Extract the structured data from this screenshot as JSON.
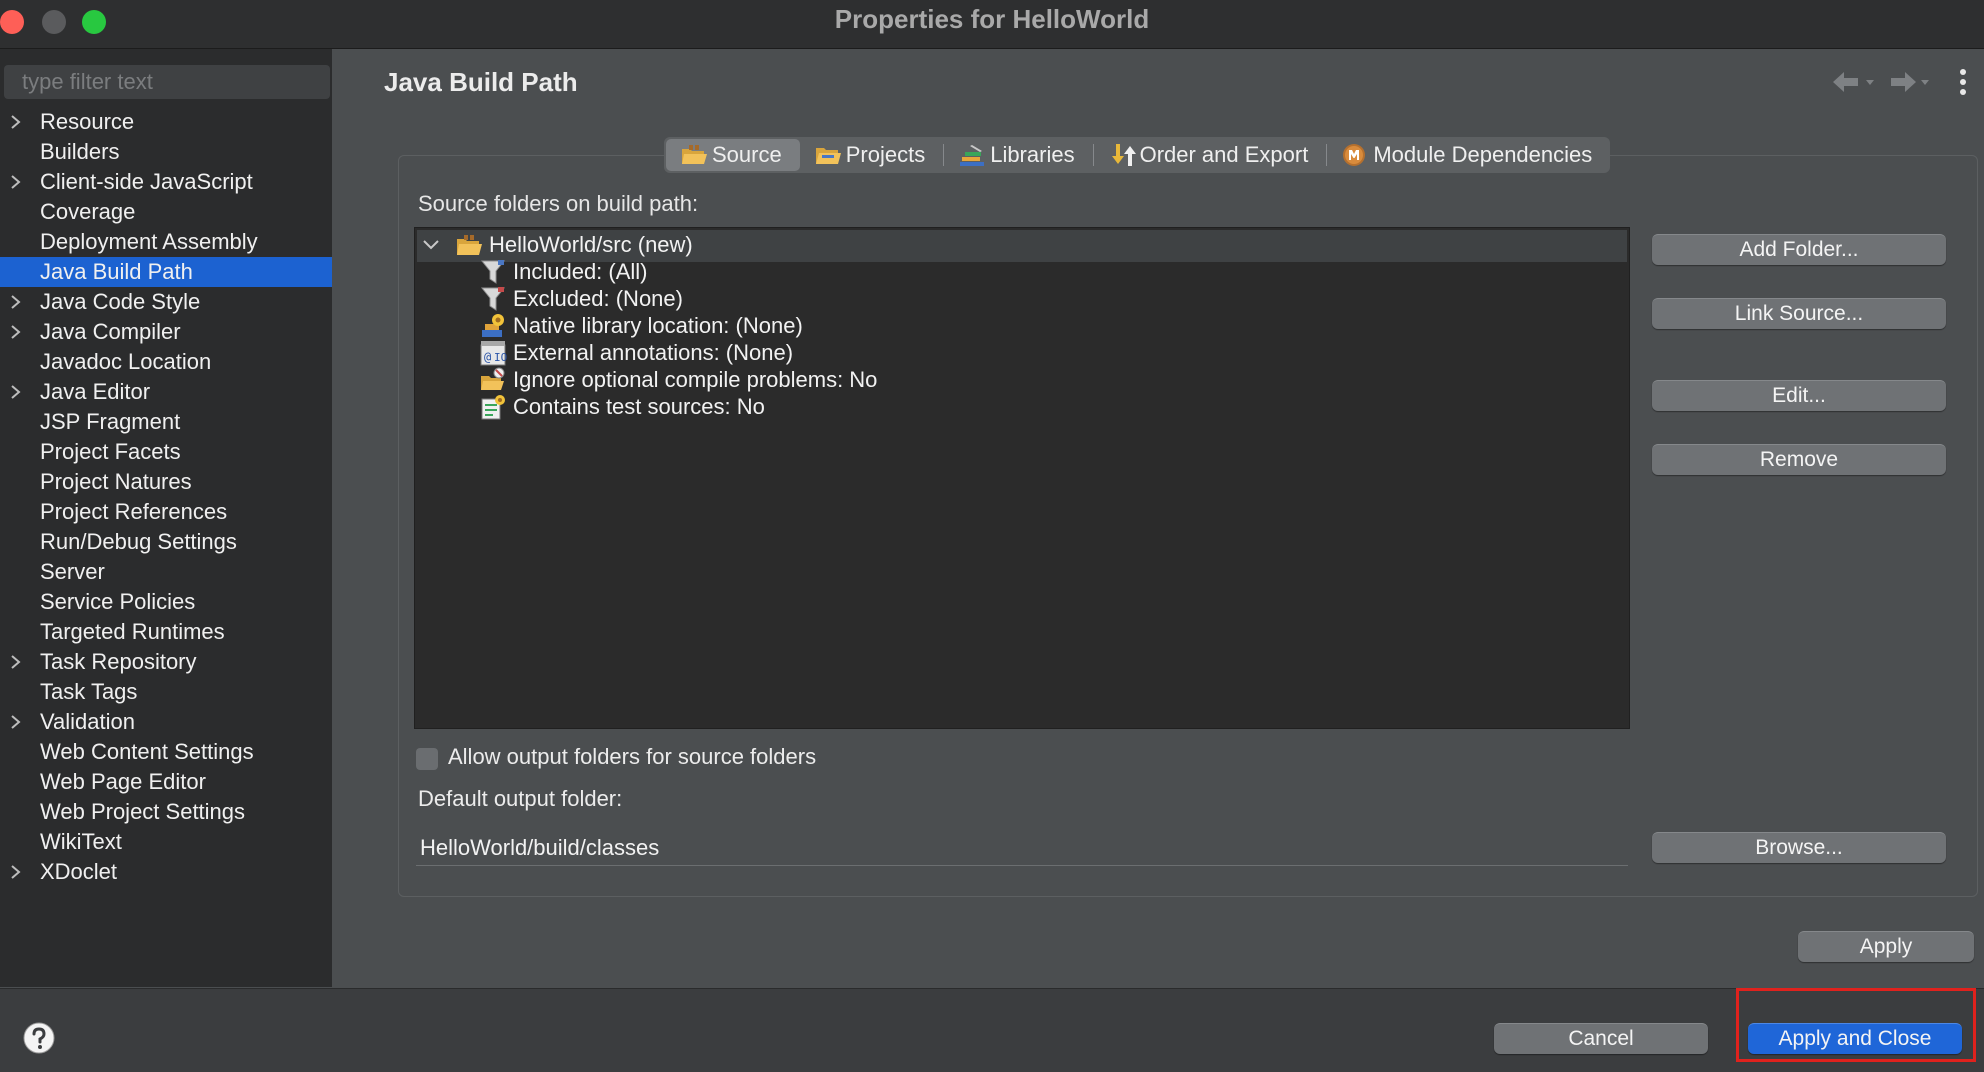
{
  "window": {
    "title": "Properties for HelloWorld",
    "controls": [
      "close",
      "minimize",
      "zoom"
    ]
  },
  "sidebar": {
    "filter_placeholder": "type filter text",
    "items": [
      {
        "label": "Resource",
        "expandable": true,
        "selected": false
      },
      {
        "label": "Builders",
        "expandable": false,
        "selected": false
      },
      {
        "label": "Client-side JavaScript",
        "expandable": true,
        "selected": false
      },
      {
        "label": "Coverage",
        "expandable": false,
        "selected": false
      },
      {
        "label": "Deployment Assembly",
        "expandable": false,
        "selected": false
      },
      {
        "label": "Java Build Path",
        "expandable": false,
        "selected": true
      },
      {
        "label": "Java Code Style",
        "expandable": true,
        "selected": false
      },
      {
        "label": "Java Compiler",
        "expandable": true,
        "selected": false
      },
      {
        "label": "Javadoc Location",
        "expandable": false,
        "selected": false
      },
      {
        "label": "Java Editor",
        "expandable": true,
        "selected": false
      },
      {
        "label": "JSP Fragment",
        "expandable": false,
        "selected": false
      },
      {
        "label": "Project Facets",
        "expandable": false,
        "selected": false
      },
      {
        "label": "Project Natures",
        "expandable": false,
        "selected": false
      },
      {
        "label": "Project References",
        "expandable": false,
        "selected": false
      },
      {
        "label": "Run/Debug Settings",
        "expandable": false,
        "selected": false
      },
      {
        "label": "Server",
        "expandable": false,
        "selected": false
      },
      {
        "label": "Service Policies",
        "expandable": false,
        "selected": false
      },
      {
        "label": "Targeted Runtimes",
        "expandable": false,
        "selected": false
      },
      {
        "label": "Task Repository",
        "expandable": true,
        "selected": false
      },
      {
        "label": "Task Tags",
        "expandable": false,
        "selected": false
      },
      {
        "label": "Validation",
        "expandable": true,
        "selected": false
      },
      {
        "label": "Web Content Settings",
        "expandable": false,
        "selected": false
      },
      {
        "label": "Web Page Editor",
        "expandable": false,
        "selected": false
      },
      {
        "label": "Web Project Settings",
        "expandable": false,
        "selected": false
      },
      {
        "label": "WikiText",
        "expandable": false,
        "selected": false
      },
      {
        "label": "XDoclet",
        "expandable": true,
        "selected": false
      }
    ]
  },
  "main": {
    "title": "Java Build Path",
    "tabs": [
      {
        "label": "Source",
        "icon": "source-folder-icon",
        "active": true
      },
      {
        "label": "Projects",
        "icon": "projects-folder-icon",
        "active": false
      },
      {
        "label": "Libraries",
        "icon": "libraries-icon",
        "active": false
      },
      {
        "label": "Order and Export",
        "icon": "order-export-icon",
        "active": false
      },
      {
        "label": "Module Dependencies",
        "icon": "module-icon",
        "active": false
      }
    ],
    "source_label": "Source folders on build path:",
    "tree": {
      "root": "HelloWorld/src (new)",
      "expanded": true,
      "children": [
        {
          "label": "Included: (All)",
          "icon": "filter-icon"
        },
        {
          "label": "Excluded: (None)",
          "icon": "filter-icon"
        },
        {
          "label": "Native library location: (None)",
          "icon": "native-library-icon"
        },
        {
          "label": "External annotations: (None)",
          "icon": "annotations-icon"
        },
        {
          "label": "Ignore optional compile problems: No",
          "icon": "ignore-problems-icon"
        },
        {
          "label": "Contains test sources: No",
          "icon": "test-sources-icon"
        }
      ]
    },
    "buttons": {
      "add_folder": "Add Folder...",
      "link_source": "Link Source...",
      "edit": "Edit...",
      "remove": "Remove",
      "browse": "Browse..."
    },
    "allow_output_label": "Allow output folders for source folders",
    "allow_output_checked": false,
    "default_output_label": "Default output folder:",
    "default_output_value": "HelloWorld/build/classes",
    "apply": "Apply"
  },
  "footer": {
    "cancel": "Cancel",
    "apply_and_close": "Apply and Close"
  },
  "colors": {
    "accent": "#1c62d1",
    "highlight": "#e0221d",
    "traffic_close": "#fe5f57",
    "traffic_min": "#5a5b5d",
    "traffic_zoom": "#28c840"
  }
}
